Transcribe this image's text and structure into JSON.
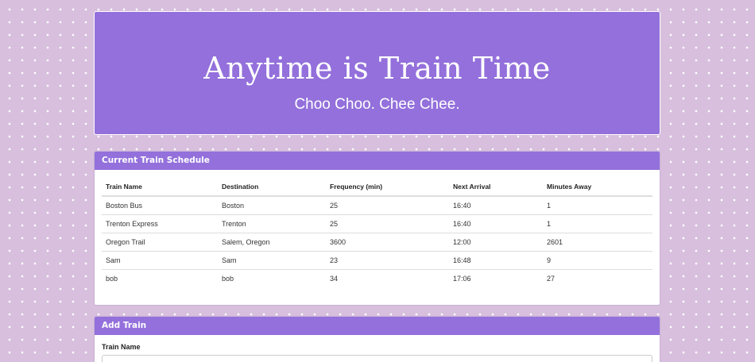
{
  "header": {
    "title": "Anytime is Train Time",
    "subtitle": "Choo Choo. Chee Chee."
  },
  "schedule": {
    "heading": "Current Train Schedule",
    "columns": [
      "Train Name",
      "Destination",
      "Frequency (min)",
      "Next Arrival",
      "Minutes Away"
    ],
    "rows": [
      [
        "Boston Bus",
        "Boston",
        "25",
        "16:40",
        "1"
      ],
      [
        "Trenton Express",
        "Trenton",
        "25",
        "16:40",
        "1"
      ],
      [
        "Oregon Trail",
        "Salem, Oregon",
        "3600",
        "12:00",
        "2601"
      ],
      [
        "Sam",
        "Sam",
        "23",
        "16:48",
        "9"
      ],
      [
        "bob",
        "bob",
        "34",
        "17:06",
        "27"
      ]
    ]
  },
  "add_train": {
    "heading": "Add Train",
    "train_name_label": "Train Name",
    "train_name_value": ""
  },
  "colors": {
    "accent": "#9370db",
    "background": "#d7bfdd"
  }
}
